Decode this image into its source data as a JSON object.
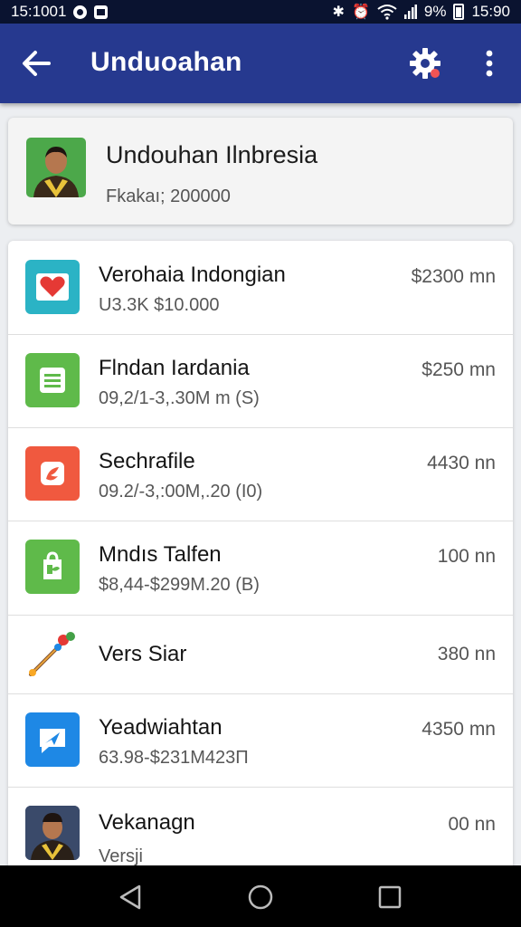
{
  "status_bar": {
    "time_left": "15:1001",
    "battery": "9%",
    "time_right": "15:90"
  },
  "app_bar": {
    "title": "Unduoahan",
    "back_icon": "arrow-left-icon",
    "settings_icon": "gear-icon",
    "more_icon": "more-vert-icon"
  },
  "profile": {
    "title": "Undouhan Ilnbresia",
    "subtitle": "Fkakaı; 200000"
  },
  "downloads": [
    {
      "title": "Verohaia Indongian",
      "sub": "U3.3K $10.000",
      "size": "$2300 mn",
      "icon": "heart-book-icon",
      "color": "#2bb3c5"
    },
    {
      "title": "Flndan Iardania",
      "sub": "09,2/1-3,.30M m (S)",
      "size": "$250 mn",
      "icon": "document-icon",
      "color": "#5fba4a"
    },
    {
      "title": "Sechrafile",
      "sub": "09.2/-3,:00M,.20 (I0)",
      "size": "4430 nn",
      "icon": "orange-app-icon",
      "color": "#f0593f"
    },
    {
      "title": "Mndıs Talfen",
      "sub": "$8,44-$299M.20 (B)",
      "size": "100 nn",
      "icon": "shopping-bag-icon",
      "color": "#5fba4a"
    },
    {
      "title": "Vers Siar",
      "sub": "",
      "size": "380 nn",
      "icon": "paintbrush-icon",
      "color": "#e06b3a"
    },
    {
      "title": "Yeadwiahtan",
      "sub": "63.98-$231M423Π",
      "size": "4350 mn",
      "icon": "chat-bubble-icon",
      "color": "#1e88e5"
    },
    {
      "title": "Vekanagn",
      "sub": "Versji",
      "size": "00 nn",
      "icon": "avatar-icon",
      "color": "#3a4a6a"
    }
  ],
  "nav": {
    "back_icon": "nav-back-triangle-icon",
    "home_icon": "nav-home-circle-icon",
    "recent_icon": "nav-recent-square-icon"
  }
}
